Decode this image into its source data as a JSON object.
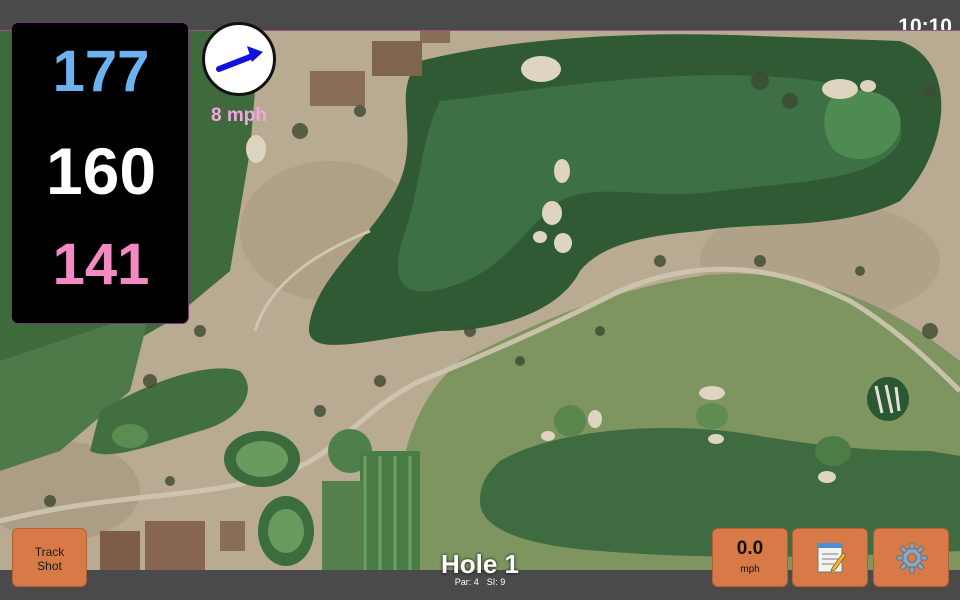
{
  "status": {
    "time": "10:10"
  },
  "distances": {
    "back": "177",
    "middle": "160",
    "front": "141"
  },
  "wind": {
    "speed_label": "8 mph",
    "arrow_icon": "wind-direction-arrow-icon",
    "color": "#f3a6e6"
  },
  "hole": {
    "title": "Hole 1",
    "par_label": "Par: 4",
    "si_label": "SI: 9"
  },
  "buttons": {
    "track_line1": "Track",
    "track_line2": "Shot",
    "speed_value": "0.0",
    "speed_unit": "mph",
    "notes_icon": "notepad-icon",
    "settings_icon": "gear-icon"
  },
  "colors": {
    "button_bg": "#d87a47",
    "back_distance": "#6cb2f1",
    "front_distance": "#f48ac4",
    "panel_bg": "#000000"
  }
}
